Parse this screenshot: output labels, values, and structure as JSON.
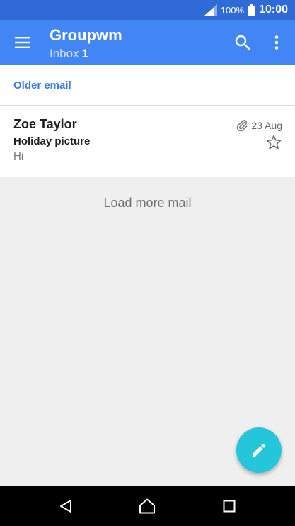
{
  "status_bar": {
    "battery": "100%",
    "time": "10:00",
    "signal_icon": "signal-icon",
    "battery_icon": "battery-icon"
  },
  "app_bar": {
    "title": "Groupwm",
    "subtitle": "Inbox",
    "unread_count": "1",
    "menu_icon": "menu-icon",
    "search_icon": "search-icon",
    "overflow_icon": "more-vert-icon"
  },
  "older_email": {
    "label": "Older email"
  },
  "messages": [
    {
      "sender": "Zoe Taylor",
      "subject": "Holiday picture",
      "snippet": "Hi",
      "date": "23 Aug",
      "has_attachment": true,
      "starred": false
    }
  ],
  "load_more": {
    "label": "Load more mail"
  },
  "fab": {
    "icon": "pencil-icon",
    "color": "#26c6da"
  },
  "colors": {
    "status_bar": "#2f6ad6",
    "app_bar": "#4285f4",
    "link": "#3b7be0",
    "background": "#efefef"
  }
}
